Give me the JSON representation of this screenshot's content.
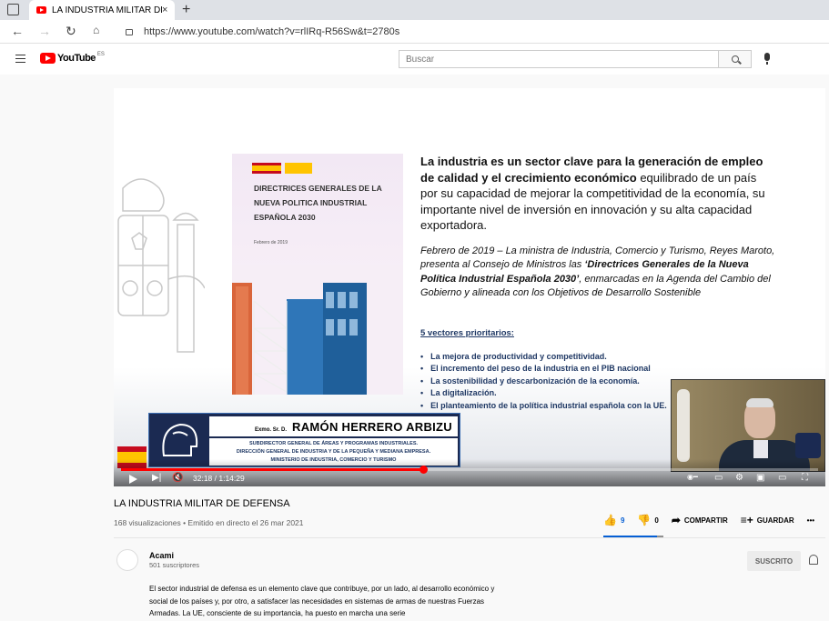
{
  "browser": {
    "tab_title": "LA INDUSTRIA MILITAR DE DEFE",
    "tab_close": "×",
    "new_tab": "+",
    "url": "https://www.youtube.com/watch?v=rlIRq-R56Sw&t=2780s"
  },
  "youtube": {
    "logo_text": "YouTube",
    "country_code": "ES",
    "search_placeholder": "Buscar"
  },
  "slide": {
    "cover_title": "DIRECTRICES GENERALES DE LA NUEVA POLITICA INDUSTRIAL ESPAÑOLA 2030",
    "cover_date": "Febrero de 2019",
    "para1_bold": "La industria es un sector clave para la generación de empleo de calidad y el crecimiento económico",
    "para1_rest": " equilibrado de un país por su capacidad de mejorar la competitividad de la economía, su importante nivel de inversión en innovación y su alta capacidad exportadora.",
    "para2_a": "Febrero de 2019 – La ministra de Industria, Comercio y Turismo, Reyes Maroto, presenta al Consejo de Ministros las ",
    "para2_b": "‘Directrices Generales de la Nueva Política Industrial Española 2030’",
    "para2_c": ", enmarcadas en la Agenda del Cambio del Gobierno y alineada con los Objetivos de Desarrollo Sostenible",
    "vectors_title": "5 vectores prioritarios:",
    "vectors": [
      "La mejora de productividad y competitividad.",
      "El incremento del peso de la industria en el PIB nacional",
      "La sostenibilidad y descarbonización de la economía.",
      "La digitalización.",
      "El planteamiento de la política industrial española con la UE."
    ]
  },
  "nameplate": {
    "honorific": "Exmo. Sr. D.",
    "name": "RAMÓN HERRERO ARBIZU",
    "line1": "SUBDIRECTOR GENERAL DE ÁREAS Y PROGRAMAS INDUSTRIALES.",
    "line2": "DIRECCIÓN GENERAL DE INDUSTRIA Y DE LA PEQUEÑA Y MEDIANA EMPRESA.",
    "line3": "MINISTERIO DE INDUSTRIA, COMERCIO Y TURISMO"
  },
  "player": {
    "time": "32:18 / 1:14:29",
    "progress_fraction": 0.434
  },
  "video": {
    "title": "LA INDUSTRIA MILITAR DE DEFENSA",
    "meta": "168 visualizaciones • Emitido en directo el 26 mar 2021",
    "likes": "9",
    "dislikes": "0",
    "share_label": "COMPARTIR",
    "save_label": "GUARDAR",
    "more": "•••"
  },
  "channel": {
    "name": "Acami",
    "subscribers": "501 suscriptores",
    "subscribe_label": "SUSCRITO",
    "description": "El sector industrial de defensa es un elemento clave que contribuye, por un lado, al desarrollo económico y social de los países y, por otro, a satisfacer las necesidades en sistemas de armas de nuestras Fuerzas Armadas. La UE, consciente de su importancia, ha puesto en marcha una serie"
  }
}
